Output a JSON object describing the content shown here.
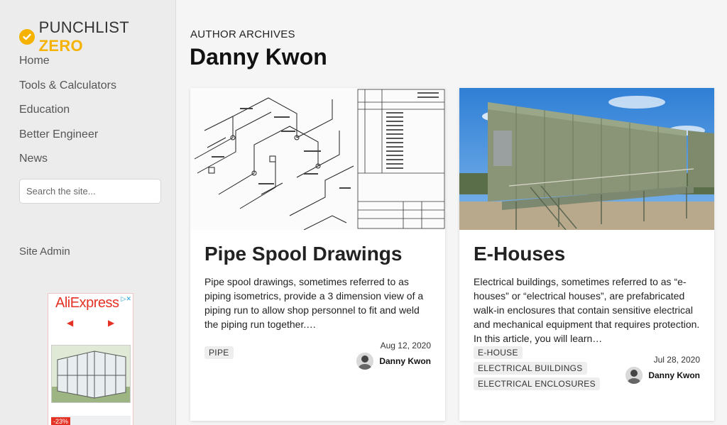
{
  "brand": {
    "name_part1": "PUNCHLIST",
    "name_part2": "ZERO",
    "accent_color": "#f5b300"
  },
  "nav": {
    "items": [
      {
        "label": "Home"
      },
      {
        "label": "Tools & Calculators"
      },
      {
        "label": "Education"
      },
      {
        "label": "Better Engineer"
      },
      {
        "label": "News"
      }
    ],
    "search_placeholder": "Search the site...",
    "site_admin": "Site Admin"
  },
  "ad": {
    "brand": "AliExpress",
    "prev": "◀",
    "next": "▶",
    "choices": "▷✕",
    "badge": "-23%"
  },
  "archive": {
    "eyebrow": "AUTHOR ARCHIVES",
    "author": "Danny Kwon"
  },
  "posts": [
    {
      "title": "Pipe Spool Drawings",
      "excerpt": "Pipe spool drawings, sometimes referred to as piping isometrics, provide a 3 dimension view of a piping run to allow shop personnel to fit and weld the piping run together.…",
      "tags": [
        "PIPE"
      ],
      "date": "Aug 12, 2020",
      "author": "Danny Kwon",
      "image": "isometric-drawing"
    },
    {
      "title": "E-Houses",
      "excerpt": "Electrical buildings, sometimes referred to as “e-houses” or “electrical houses”, are prefabricated walk-in enclosures that contain sensitive electrical and mechanical equipment that requires protection. In this article, you will learn…",
      "tags": [
        "E-HOUSE",
        "ELECTRICAL BUILDINGS",
        "ELECTRICAL ENCLOSURES"
      ],
      "date": "Jul 28, 2020",
      "author": "Danny Kwon",
      "image": "e-house-photo"
    }
  ]
}
